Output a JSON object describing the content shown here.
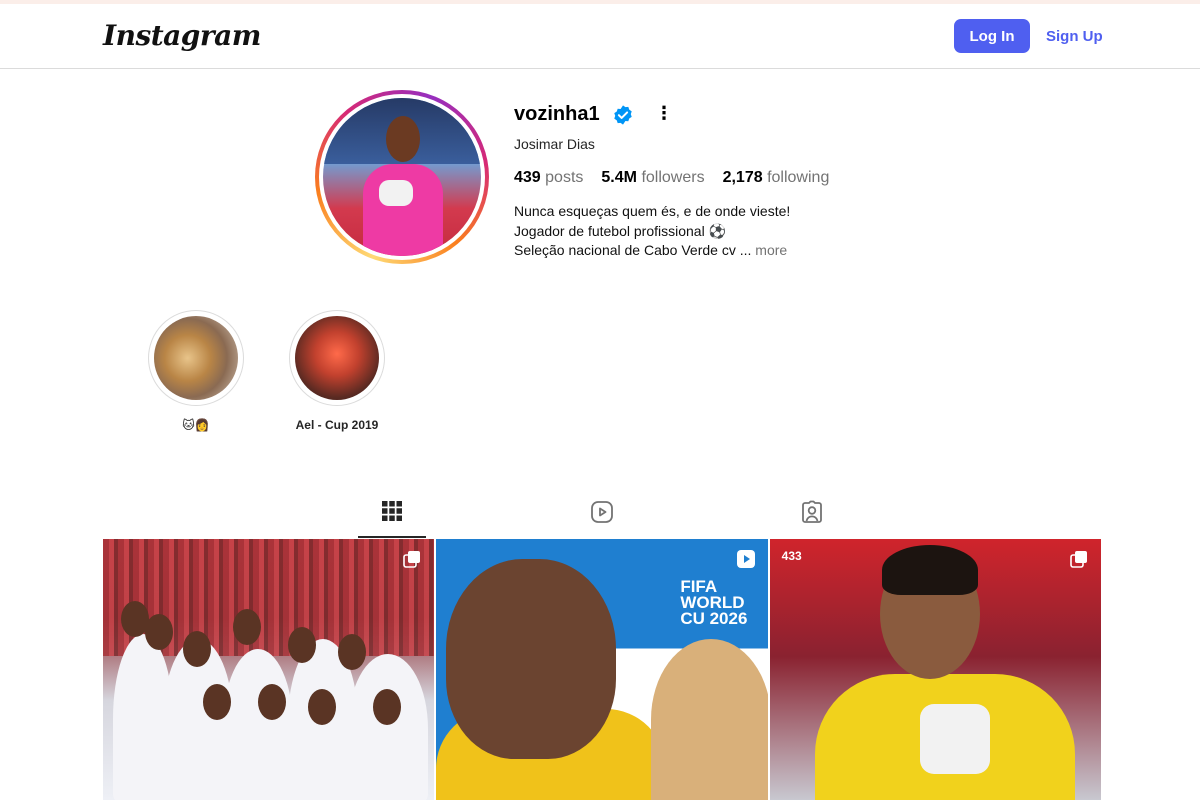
{
  "header": {
    "logo_text": "Instagram",
    "login_label": "Log In",
    "signup_label": "Sign Up"
  },
  "profile": {
    "username": "vozinha1",
    "full_name": "Josimar Dias",
    "stats": [
      {
        "value": "439",
        "label": "posts"
      },
      {
        "value": "5.4M",
        "label": "followers"
      },
      {
        "value": "2,178",
        "label": "following"
      }
    ],
    "bio": {
      "line1": "Nunca esqueças quem és, e de onde vieste!",
      "line2": "Jogador de futebol profissional ⚽",
      "line3": "Seleção nacional de Cabo Verde cv ...",
      "more_label": "more"
    }
  },
  "highlights": [
    {
      "label": "🐱👩"
    },
    {
      "label": "Ael - Cup 2019"
    }
  ],
  "tabs": [
    {
      "name": "posts",
      "icon": "grid-icon",
      "active": true
    },
    {
      "name": "reels",
      "icon": "reels-icon",
      "active": false
    },
    {
      "name": "tagged",
      "icon": "tagged-icon",
      "active": false
    }
  ],
  "posts": [
    {
      "type": "carousel",
      "badge_icon": "multiple-icon"
    },
    {
      "type": "reel",
      "badge_icon": "reel-icon",
      "overlay_text": "FIFA WORLD CU 2026"
    },
    {
      "type": "carousel",
      "badge_icon": "multiple-icon",
      "watermark": "433"
    }
  ],
  "colors": {
    "accent": "#4f5ff0",
    "muted_text": "#737373",
    "verified": "#0095f6"
  }
}
